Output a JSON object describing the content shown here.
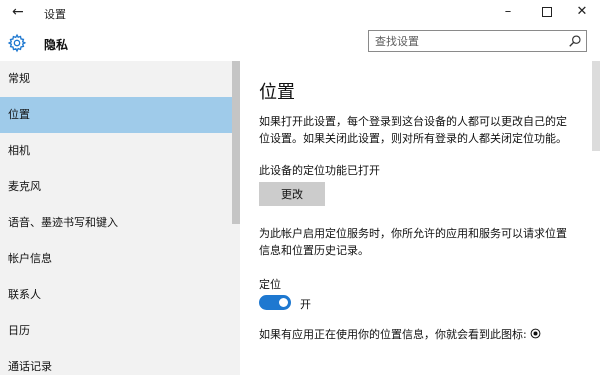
{
  "window": {
    "title": "设置",
    "back_icon": "back-arrow-icon",
    "minimize_glyph": "–",
    "close_glyph": "✕"
  },
  "header": {
    "section_title": "隐私",
    "section_icon": "gear-icon",
    "search_placeholder": "查找设置"
  },
  "sidebar": {
    "items": [
      {
        "label": "常规",
        "active": false
      },
      {
        "label": "位置",
        "active": true
      },
      {
        "label": "相机",
        "active": false
      },
      {
        "label": "麦克风",
        "active": false
      },
      {
        "label": "语音、墨迹书写和键入",
        "active": false
      },
      {
        "label": "帐户信息",
        "active": false
      },
      {
        "label": "联系人",
        "active": false
      },
      {
        "label": "日历",
        "active": false
      },
      {
        "label": "通话记录",
        "active": false
      }
    ]
  },
  "main": {
    "title": "位置",
    "description_line1": "如果打开此设置，每个登录到这台设备的人都可以更改自己的定",
    "description_line2": "位设置。如果关闭此设置，则对所有登录的人都关闭定位功能。",
    "device_status": "此设备的定位功能已打开",
    "change_button": "更改",
    "service_desc_line1": "为此帐户启用定位服务时，你所允许的应用和服务可以请求位置",
    "service_desc_line2": "信息和位置历史记录。",
    "location_label": "定位",
    "toggle_state": "开",
    "toggle_on": true,
    "usage_note": "如果有应用正在使用你的位置信息，你就会看到此图标:"
  },
  "colors": {
    "active_item": "#9fcbea",
    "toggle_on": "#1e78d0",
    "sidebar_bg": "#f2f2f2"
  }
}
